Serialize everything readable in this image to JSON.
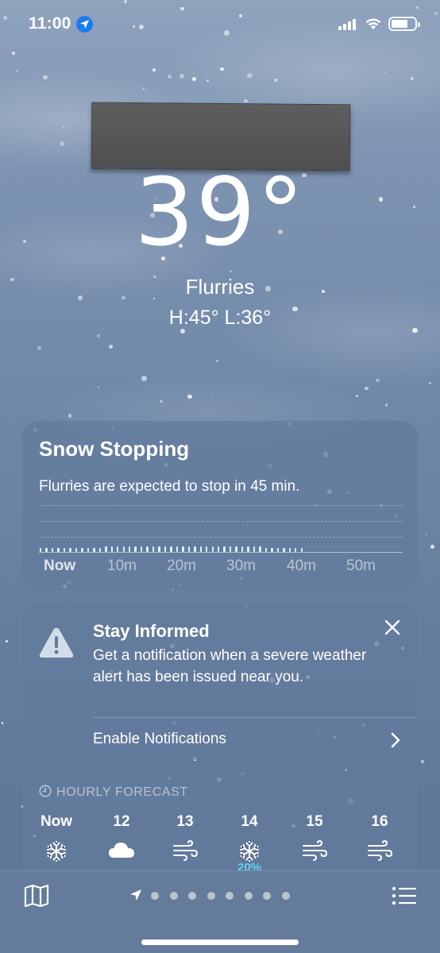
{
  "status_bar": {
    "time": "11:00"
  },
  "weather": {
    "temperature": "39°",
    "condition": "Flurries",
    "high_low": "H:45°  L:36°"
  },
  "precip_card": {
    "title": "Snow Stopping",
    "description": "Flurries are expected to stop in 45 min.",
    "chart_data": {
      "type": "bar",
      "x_labels": [
        "Now",
        "10m",
        "20m",
        "30m",
        "40m",
        "50m"
      ],
      "minutes_with_snow": 45,
      "intensity_note": "light"
    }
  },
  "alert_card": {
    "title": "Stay Informed",
    "body": "Get a notification when a severe weather alert has been issued near you.",
    "action": "Enable Notifications"
  },
  "hourly": {
    "header": "HOURLY FORECAST",
    "hours": [
      {
        "label": "Now",
        "icon": "snowflake-icon"
      },
      {
        "label": "12",
        "icon": "cloud-icon"
      },
      {
        "label": "13",
        "icon": "wind-icon"
      },
      {
        "label": "14",
        "icon": "snowflake-icon",
        "precip": "20%"
      },
      {
        "label": "15",
        "icon": "wind-icon"
      },
      {
        "label": "16",
        "icon": "wind-icon"
      }
    ]
  },
  "toolbar": {
    "page_count": 9,
    "active_page": 0
  },
  "colors": {
    "accent_blue": "#1a7cf0",
    "precip_cyan": "#5fd3f0",
    "card_bg": "#627a9c"
  }
}
